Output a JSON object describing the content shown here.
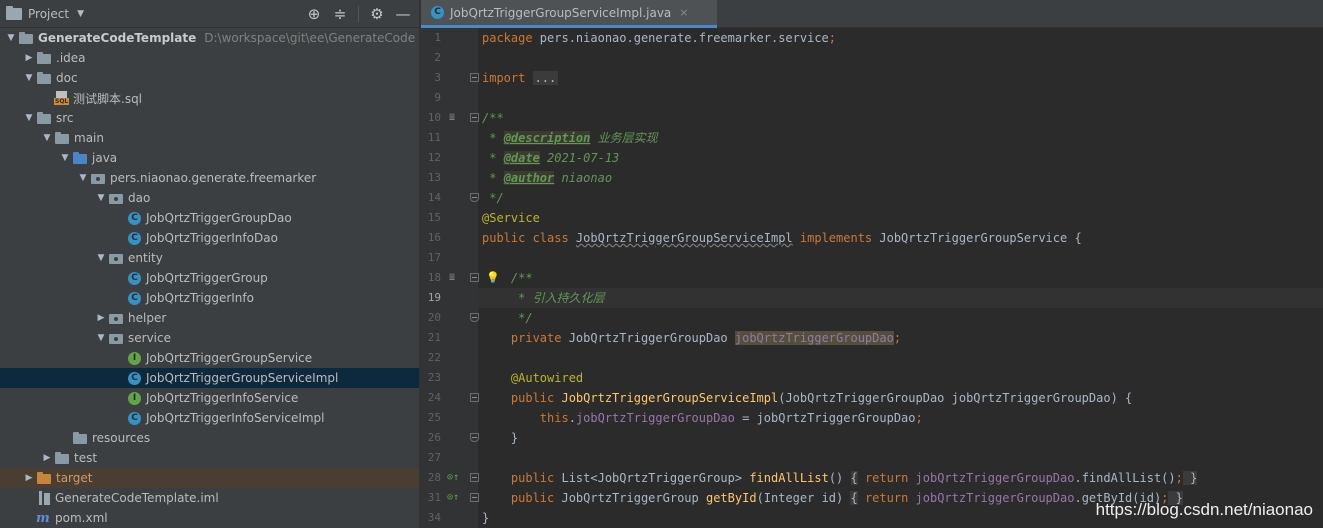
{
  "project_panel": {
    "title": "Project",
    "tools": {
      "locate": "⊕",
      "collapse": "≑",
      "settings": "⚙",
      "hide": "—"
    },
    "tree": [
      {
        "text": "GenerateCodeTemplate",
        "hint": "D:\\workspace\\git\\ee\\GenerateCode",
        "kind": "module",
        "indent": 0,
        "arrow": "open"
      },
      {
        "text": ".idea",
        "kind": "folder",
        "indent": 1,
        "arrow": "closed"
      },
      {
        "text": "doc",
        "kind": "folder",
        "indent": 1,
        "arrow": "open"
      },
      {
        "text": "测试脚本.sql",
        "kind": "sql",
        "indent": 2,
        "arrow": "none"
      },
      {
        "text": "src",
        "kind": "folder",
        "indent": 1,
        "arrow": "open"
      },
      {
        "text": "main",
        "kind": "folder",
        "indent": 2,
        "arrow": "open"
      },
      {
        "text": "java",
        "kind": "folder-blue",
        "indent": 3,
        "arrow": "open"
      },
      {
        "text": "pers.niaonao.generate.freemarker",
        "kind": "package",
        "indent": 4,
        "arrow": "open"
      },
      {
        "text": "dao",
        "kind": "package",
        "indent": 5,
        "arrow": "open"
      },
      {
        "text": "JobQrtzTriggerGroupDao",
        "kind": "class",
        "indent": 6,
        "arrow": "none"
      },
      {
        "text": "JobQrtzTriggerInfoDao",
        "kind": "class",
        "indent": 6,
        "arrow": "none"
      },
      {
        "text": "entity",
        "kind": "package",
        "indent": 5,
        "arrow": "open"
      },
      {
        "text": "JobQrtzTriggerGroup",
        "kind": "class",
        "indent": 6,
        "arrow": "none"
      },
      {
        "text": "JobQrtzTriggerInfo",
        "kind": "class",
        "indent": 6,
        "arrow": "none"
      },
      {
        "text": "helper",
        "kind": "package",
        "indent": 5,
        "arrow": "closed"
      },
      {
        "text": "service",
        "kind": "package",
        "indent": 5,
        "arrow": "open"
      },
      {
        "text": "JobQrtzTriggerGroupService",
        "kind": "interface",
        "indent": 6,
        "arrow": "none"
      },
      {
        "text": "JobQrtzTriggerGroupServiceImpl",
        "kind": "class",
        "indent": 6,
        "arrow": "none",
        "selected": true
      },
      {
        "text": "JobQrtzTriggerInfoService",
        "kind": "interface",
        "indent": 6,
        "arrow": "none"
      },
      {
        "text": "JobQrtzTriggerInfoServiceImpl",
        "kind": "class",
        "indent": 6,
        "arrow": "none"
      },
      {
        "text": "resources",
        "kind": "folder-res",
        "indent": 3,
        "arrow": "none"
      },
      {
        "text": "test",
        "kind": "folder",
        "indent": 2,
        "arrow": "closed"
      },
      {
        "text": "target",
        "kind": "folder-orange",
        "indent": 1,
        "arrow": "closed",
        "highlight": true
      },
      {
        "text": "GenerateCodeTemplate.iml",
        "kind": "iml",
        "indent": 1,
        "arrow": "none"
      },
      {
        "text": "pom.xml",
        "kind": "maven",
        "indent": 1,
        "arrow": "none"
      }
    ]
  },
  "editor": {
    "tab": {
      "label": "JobQrtzTriggerGroupServiceImpl.java",
      "icon": "C",
      "close": "×"
    },
    "current_line": "19",
    "lines": [
      {
        "n": "1",
        "tokens": [
          [
            "kw",
            "package "
          ],
          [
            "",
            "pers.niaonao.generate.freemarker.service"
          ],
          [
            "kw",
            ";"
          ]
        ]
      },
      {
        "n": "2",
        "tokens": []
      },
      {
        "n": "3",
        "fold": "start",
        "tokens": [
          [
            "kw",
            "import "
          ],
          [
            "folded",
            "..."
          ]
        ]
      },
      {
        "n": "9",
        "tokens": []
      },
      {
        "n": "10",
        "fold": "start",
        "doc": true,
        "tokens": [
          [
            "cm",
            "/**"
          ]
        ]
      },
      {
        "n": "11",
        "tokens": [
          [
            "cm",
            " * "
          ],
          [
            "tag",
            "@description"
          ],
          [
            "cm",
            " 业务层实现"
          ]
        ]
      },
      {
        "n": "12",
        "tokens": [
          [
            "cm",
            " * "
          ],
          [
            "tag",
            "@date"
          ],
          [
            "cm",
            " 2021-07-13"
          ]
        ]
      },
      {
        "n": "13",
        "tokens": [
          [
            "cm",
            " * "
          ],
          [
            "tag",
            "@author"
          ],
          [
            "cm",
            " niaonao"
          ]
        ]
      },
      {
        "n": "14",
        "fold": "end",
        "tokens": [
          [
            "cm",
            " */"
          ]
        ]
      },
      {
        "n": "15",
        "tokens": [
          [
            "ann",
            "@Service"
          ]
        ]
      },
      {
        "n": "16",
        "tokens": [
          [
            "kw",
            "public class "
          ],
          [
            "wavy",
            "JobQrtzTriggerGroupServiceImpl"
          ],
          [
            "kw",
            " implements "
          ],
          [
            "",
            "JobQrtzTriggerGroupService {"
          ]
        ]
      },
      {
        "n": "17",
        "tokens": []
      },
      {
        "n": "18",
        "fold": "start",
        "doc": true,
        "bulb": true,
        "tokens": [
          [
            "",
            "    "
          ],
          [
            "cm",
            "/**"
          ]
        ]
      },
      {
        "n": "19",
        "tokens": [
          [
            "cm",
            "     * 引入持久化层"
          ]
        ]
      },
      {
        "n": "20",
        "fold": "end",
        "tokens": [
          [
            "cm",
            "     */"
          ]
        ]
      },
      {
        "n": "21",
        "tokens": [
          [
            "kw",
            "    private "
          ],
          [
            "",
            "JobQrtzTriggerGroupDao "
          ],
          [
            "fld-hl",
            "jobQrtzTriggerGroupDao"
          ],
          [
            "kw",
            ";"
          ]
        ]
      },
      {
        "n": "22",
        "tokens": []
      },
      {
        "n": "23",
        "tokens": [
          [
            "ann",
            "    @Autowired"
          ]
        ]
      },
      {
        "n": "24",
        "fold": "start",
        "tokens": [
          [
            "kw",
            "    public "
          ],
          [
            "mth",
            "JobQrtzTriggerGroupServiceImpl"
          ],
          [
            "",
            "(JobQrtzTriggerGroupDao jobQrtzTriggerGroupDao) {"
          ]
        ]
      },
      {
        "n": "25",
        "tokens": [
          [
            "kw",
            "        this"
          ],
          [
            "",
            "."
          ],
          [
            "fld",
            "jobQrtzTriggerGroupDao"
          ],
          [
            "",
            " = jobQrtzTriggerGroupDao"
          ],
          [
            "kw",
            ";"
          ]
        ]
      },
      {
        "n": "26",
        "fold": "end",
        "tokens": [
          [
            "",
            "    }"
          ]
        ]
      },
      {
        "n": "27",
        "tokens": []
      },
      {
        "n": "28",
        "fold": "start",
        "override": true,
        "tokens": [
          [
            "kw",
            "    public "
          ],
          [
            "",
            "List<JobQrtzTriggerGroup> "
          ],
          [
            "mth",
            "findAllList"
          ],
          [
            "",
            "() "
          ],
          [
            "brace",
            "{"
          ],
          [
            "kw",
            " return "
          ],
          [
            "fld",
            "jobQrtzTriggerGroupDao"
          ],
          [
            "",
            ".findAllList()"
          ],
          [
            "kw",
            ";"
          ],
          [
            "brace",
            " }"
          ]
        ]
      },
      {
        "n": "31",
        "fold": "start",
        "override": true,
        "tokens": [
          [
            "kw",
            "    public "
          ],
          [
            "",
            "JobQrtzTriggerGroup "
          ],
          [
            "mth",
            "getById"
          ],
          [
            "",
            "(Integer id) "
          ],
          [
            "brace",
            "{"
          ],
          [
            "kw",
            " return "
          ],
          [
            "fld",
            "jobQrtzTriggerGroupDao"
          ],
          [
            "",
            ".getById(id)"
          ],
          [
            "kw",
            ";"
          ],
          [
            "brace",
            " }"
          ]
        ]
      },
      {
        "n": "34",
        "tokens": [
          [
            "",
            "}"
          ]
        ]
      }
    ]
  },
  "watermark": "https://blog.csdn.net/niaonao",
  "colors": {
    "selection": "#0d293e",
    "accent": "#4a88c7",
    "keyword": "#cc7832",
    "comment": "#629755",
    "annotation": "#bbb529",
    "field": "#9876aa",
    "method": "#ffc66d"
  }
}
